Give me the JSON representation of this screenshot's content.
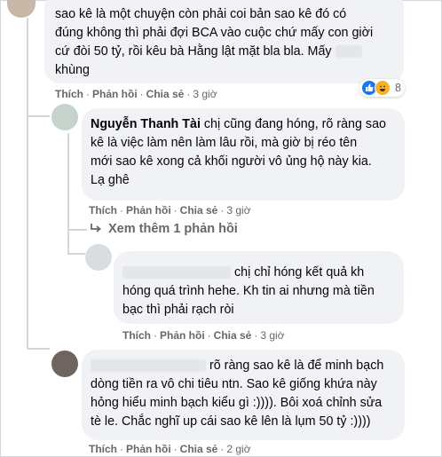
{
  "comments": [
    {
      "text_lines": [
        "sao kê là một chuyện còn phải coi bản sao kê đó có",
        "đúng không thì phải đợi BCA vào cuộc chứ mấy con giời",
        "cứ đòi 50 tỷ, rồi kêu bà Hằng lật mặt bla bla. Mấy",
        "khùng"
      ],
      "actions": {
        "like": "Thích",
        "reply": "Phản hồi",
        "share": "Chia sẻ",
        "time": "3 giờ"
      },
      "reaction_count": "8"
    },
    {
      "author": "Nguyễn Thanh Tài",
      "text_first": "chị cũng đang hóng, rõ ràng sao",
      "text_lines": [
        "kê là việc làm nên làm lâu rồi, mà giờ bị réo tên",
        "mới sao kê xong cả khối người vô ủng hộ này kia.",
        "Lạ ghê"
      ],
      "actions": {
        "like": "Thích",
        "reply": "Phản hồi",
        "share": "Chia sẻ",
        "time": "3 giờ"
      }
    },
    {
      "view_more": "Xem thêm 1 phản hồi"
    },
    {
      "text_first": "chị chỉ hóng kết quả kh",
      "text_lines": [
        "hóng quá trình hehe. Kh tin ai nhưng mà tiền",
        "bạc thì phải rạch ròi"
      ],
      "actions": {
        "like": "Thích",
        "reply": "Phản hồi",
        "share": "Chia sẻ",
        "time": "3 giờ"
      }
    },
    {
      "text_first": "rõ ràng sao kê là để minh bạch",
      "text_lines": [
        "dòng tiền ra vô chi tiêu ntn. Sao kê giống khứa này",
        "hỏng hiểu minh bạch kiểu gì :)))). Bôi xoá chỉnh sửa",
        "tè le. Chắc nghĩ up cái sao kê lên là lụm 50 tỷ :))))"
      ],
      "actions": {
        "like": "Thích",
        "reply": "Phản hồi",
        "share": "Chia sẻ",
        "time": "2 giờ"
      }
    }
  ],
  "colors": {
    "bubble": "#f0f2f5",
    "meta": "#65676b",
    "like_blue": "#1877f2"
  }
}
